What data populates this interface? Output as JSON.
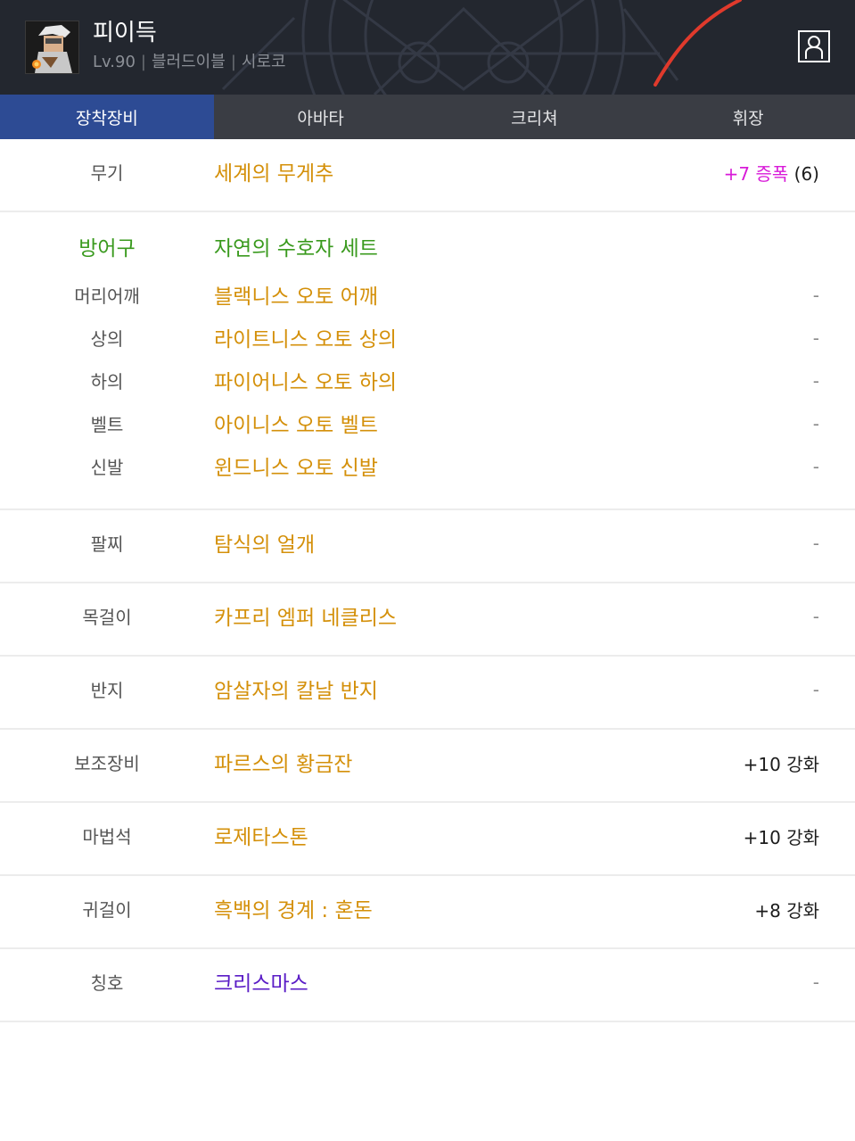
{
  "header": {
    "character_name": "피이득",
    "level": "Lv.90",
    "job": "블러드이블",
    "guild": "시로코",
    "avatar_icon": "character-portrait-icon",
    "profile_icon": "person-silhouette-icon"
  },
  "tabs": [
    {
      "label": "장착장비",
      "active": true
    },
    {
      "label": "아바타",
      "active": false
    },
    {
      "label": "크리쳐",
      "active": false
    },
    {
      "label": "휘장",
      "active": false
    }
  ],
  "colors": {
    "item_name": "#d4900a",
    "set_name": "#3a9a1e",
    "title_name": "#5a1cc6",
    "amplify": "#d81ad8",
    "active_tab": "#2d4b94"
  },
  "equipment": {
    "weapon": {
      "slot": "무기",
      "name": "세계의 무게추",
      "amp": "+7 증폭",
      "amp_extra": "(6)"
    },
    "armor_set": {
      "slot": "방어구",
      "name": "자연의 수호자 세트"
    },
    "armor": [
      {
        "slot": "머리어깨",
        "name": "블랙니스 오토 어깨",
        "value": "-"
      },
      {
        "slot": "상의",
        "name": "라이트니스 오토 상의",
        "value": "-"
      },
      {
        "slot": "하의",
        "name": "파이어니스 오토 하의",
        "value": "-"
      },
      {
        "slot": "벨트",
        "name": "아이니스 오토 벨트",
        "value": "-"
      },
      {
        "slot": "신발",
        "name": "윈드니스 오토 신발",
        "value": "-"
      }
    ],
    "others": [
      {
        "slot": "팔찌",
        "name": "탐식의 얼개",
        "value": "-"
      },
      {
        "slot": "목걸이",
        "name": "카프리 엠퍼 네클리스",
        "value": "-"
      },
      {
        "slot": "반지",
        "name": "암살자의 칼날 반지",
        "value": "-"
      },
      {
        "slot": "보조장비",
        "name": "파르스의 황금잔",
        "value": "+10 강화"
      },
      {
        "slot": "마법석",
        "name": "로제타스톤",
        "value": "+10 강화"
      },
      {
        "slot": "귀걸이",
        "name": "흑백의 경계 : 혼돈",
        "value": "+8 강화"
      },
      {
        "slot": "칭호",
        "name": "크리스마스",
        "value": "-"
      }
    ]
  }
}
